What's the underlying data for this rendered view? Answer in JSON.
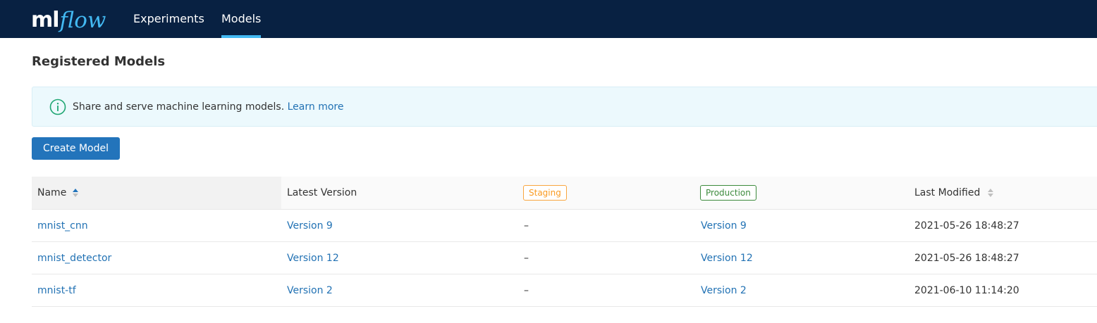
{
  "app": {
    "logo_ml": "ml",
    "logo_flow": "flow"
  },
  "nav": {
    "items": [
      {
        "label": "Experiments",
        "active": false
      },
      {
        "label": "Models",
        "active": true
      }
    ]
  },
  "page": {
    "title": "Registered Models"
  },
  "banner": {
    "icon": "info-circle-icon",
    "text": "Share and serve machine learning models.",
    "link_label": "Learn more"
  },
  "toolbar": {
    "create_label": "Create Model"
  },
  "table": {
    "headers": {
      "name": "Name",
      "latest": "Latest Version",
      "staging": "Staging",
      "production": "Production",
      "modified": "Last Modified"
    },
    "sort": {
      "column": "Name",
      "direction": "ascending"
    },
    "rows": [
      {
        "name": "mnist_cnn",
        "latest": "Version 9",
        "staging": "–",
        "production": "Version 9",
        "modified": "2021-05-26 18:48:27"
      },
      {
        "name": "mnist_detector",
        "latest": "Version 12",
        "staging": "–",
        "production": "Version 12",
        "modified": "2021-05-26 18:48:27"
      },
      {
        "name": "mnist-tf",
        "latest": "Version 2",
        "staging": "–",
        "production": "Version 2",
        "modified": "2021-06-10 11:14:20"
      }
    ]
  },
  "colors": {
    "nav_bg": "#082142",
    "accent": "#43b9f2",
    "link": "#2272b4",
    "button": "#2374bb",
    "staging": "#fa9a20",
    "production": "#3c8a3c",
    "banner_bg": "#ecf9fd",
    "info_icon": "#1ea672"
  }
}
